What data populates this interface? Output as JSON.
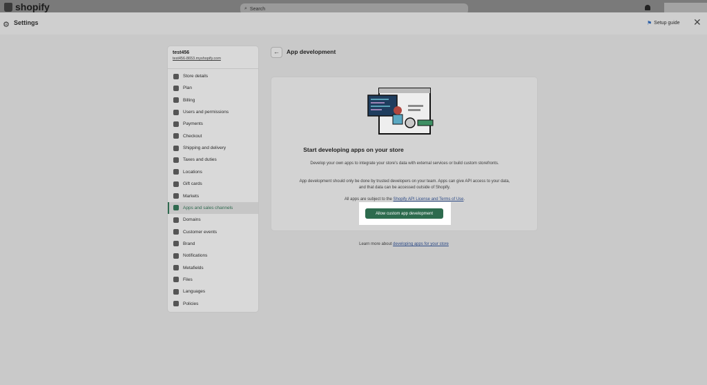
{
  "topbar": {
    "brand": "shopify",
    "search_placeholder": "Search"
  },
  "header": {
    "title": "Settings",
    "setup_guide": "Setup guide"
  },
  "store": {
    "name": "test456",
    "url": "test456-8653.myshopify.com"
  },
  "sidebar": {
    "items": [
      {
        "label": "Store details",
        "icon": "store-icon"
      },
      {
        "label": "Plan",
        "icon": "plan-icon"
      },
      {
        "label": "Billing",
        "icon": "billing-icon"
      },
      {
        "label": "Users and permissions",
        "icon": "users-icon"
      },
      {
        "label": "Payments",
        "icon": "payments-icon"
      },
      {
        "label": "Checkout",
        "icon": "checkout-icon"
      },
      {
        "label": "Shipping and delivery",
        "icon": "shipping-icon"
      },
      {
        "label": "Taxes and duties",
        "icon": "taxes-icon"
      },
      {
        "label": "Locations",
        "icon": "location-icon"
      },
      {
        "label": "Gift cards",
        "icon": "gift-card-icon"
      },
      {
        "label": "Markets",
        "icon": "markets-icon"
      },
      {
        "label": "Apps and sales channels",
        "icon": "apps-icon",
        "active": true
      },
      {
        "label": "Domains",
        "icon": "domains-icon"
      },
      {
        "label": "Customer events",
        "icon": "customer-events-icon"
      },
      {
        "label": "Brand",
        "icon": "brand-icon"
      },
      {
        "label": "Notifications",
        "icon": "notifications-icon"
      },
      {
        "label": "Metafields",
        "icon": "metafields-icon"
      },
      {
        "label": "Files",
        "icon": "files-icon"
      },
      {
        "label": "Languages",
        "icon": "languages-icon"
      },
      {
        "label": "Policies",
        "icon": "policies-icon"
      }
    ]
  },
  "main": {
    "title": "App development",
    "card": {
      "heading": "Start developing apps on your store",
      "paragraph1": "Develop your own apps to integrate your store's data with external services or build custom storefronts.",
      "paragraph2": "App development should only be done by trusted developers on your team. Apps can give API access to your data, and that data can be accessed outside of Shopify.",
      "terms_prefix": "All apps are subject to the",
      "terms_link": "Shopify API License and Terms of Use",
      "terms_suffix": ".",
      "button_label": "Allow custom app development"
    },
    "learn_more_prefix": "Learn more about",
    "learn_more_link": "developing apps for your store"
  },
  "colors": {
    "accent_green": "#2d6b4e",
    "link_blue": "#2c4a86"
  }
}
